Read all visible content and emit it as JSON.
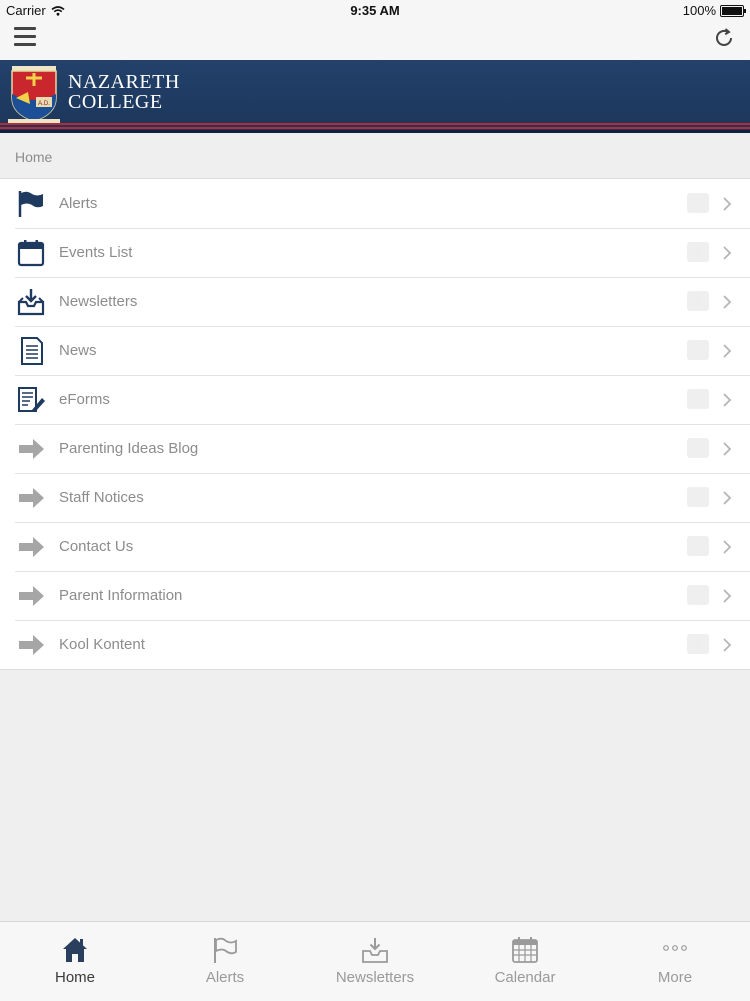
{
  "status_bar": {
    "carrier": "Carrier",
    "time": "9:35 AM",
    "battery": "100%"
  },
  "banner": {
    "name_line1": "NAZARETH",
    "name_line2": "COLLEGE"
  },
  "breadcrumb": "Home",
  "menu_items": [
    {
      "label": "Alerts",
      "icon": "flag-icon",
      "badge": "0"
    },
    {
      "label": "Events List",
      "icon": "calendar-icon",
      "badge": "0"
    },
    {
      "label": "Newsletters",
      "icon": "inbox-download-icon",
      "badge": "0"
    },
    {
      "label": "News",
      "icon": "document-icon",
      "badge": "0"
    },
    {
      "label": "eForms",
      "icon": "form-pencil-icon",
      "badge": "0"
    },
    {
      "label": "Parenting Ideas Blog",
      "icon": "arrow-right-icon",
      "badge": "0"
    },
    {
      "label": "Staff Notices",
      "icon": "arrow-right-icon",
      "badge": "0"
    },
    {
      "label": "Contact Us",
      "icon": "arrow-right-icon",
      "badge": "0"
    },
    {
      "label": "Parent Information",
      "icon": "arrow-right-icon",
      "badge": "0"
    },
    {
      "label": "Kool Kontent",
      "icon": "arrow-right-icon",
      "badge": "0"
    }
  ],
  "tab_bar": [
    {
      "label": "Home",
      "icon": "home-icon",
      "active": true
    },
    {
      "label": "Alerts",
      "icon": "flag-icon",
      "active": false
    },
    {
      "label": "Newsletters",
      "icon": "inbox-download-icon",
      "active": false
    },
    {
      "label": "Calendar",
      "icon": "calendar-grid-icon",
      "active": false
    },
    {
      "label": "More",
      "icon": "more-dots-icon",
      "active": false
    }
  ],
  "colors": {
    "banner_navy": "#1c365a",
    "banner_stripe_red": "#b82b34",
    "icon_navy": "#1f3a5f",
    "arrow_gray": "#a6a6a6",
    "text_gray": "#8c8c8c",
    "background": "#efeff0"
  }
}
